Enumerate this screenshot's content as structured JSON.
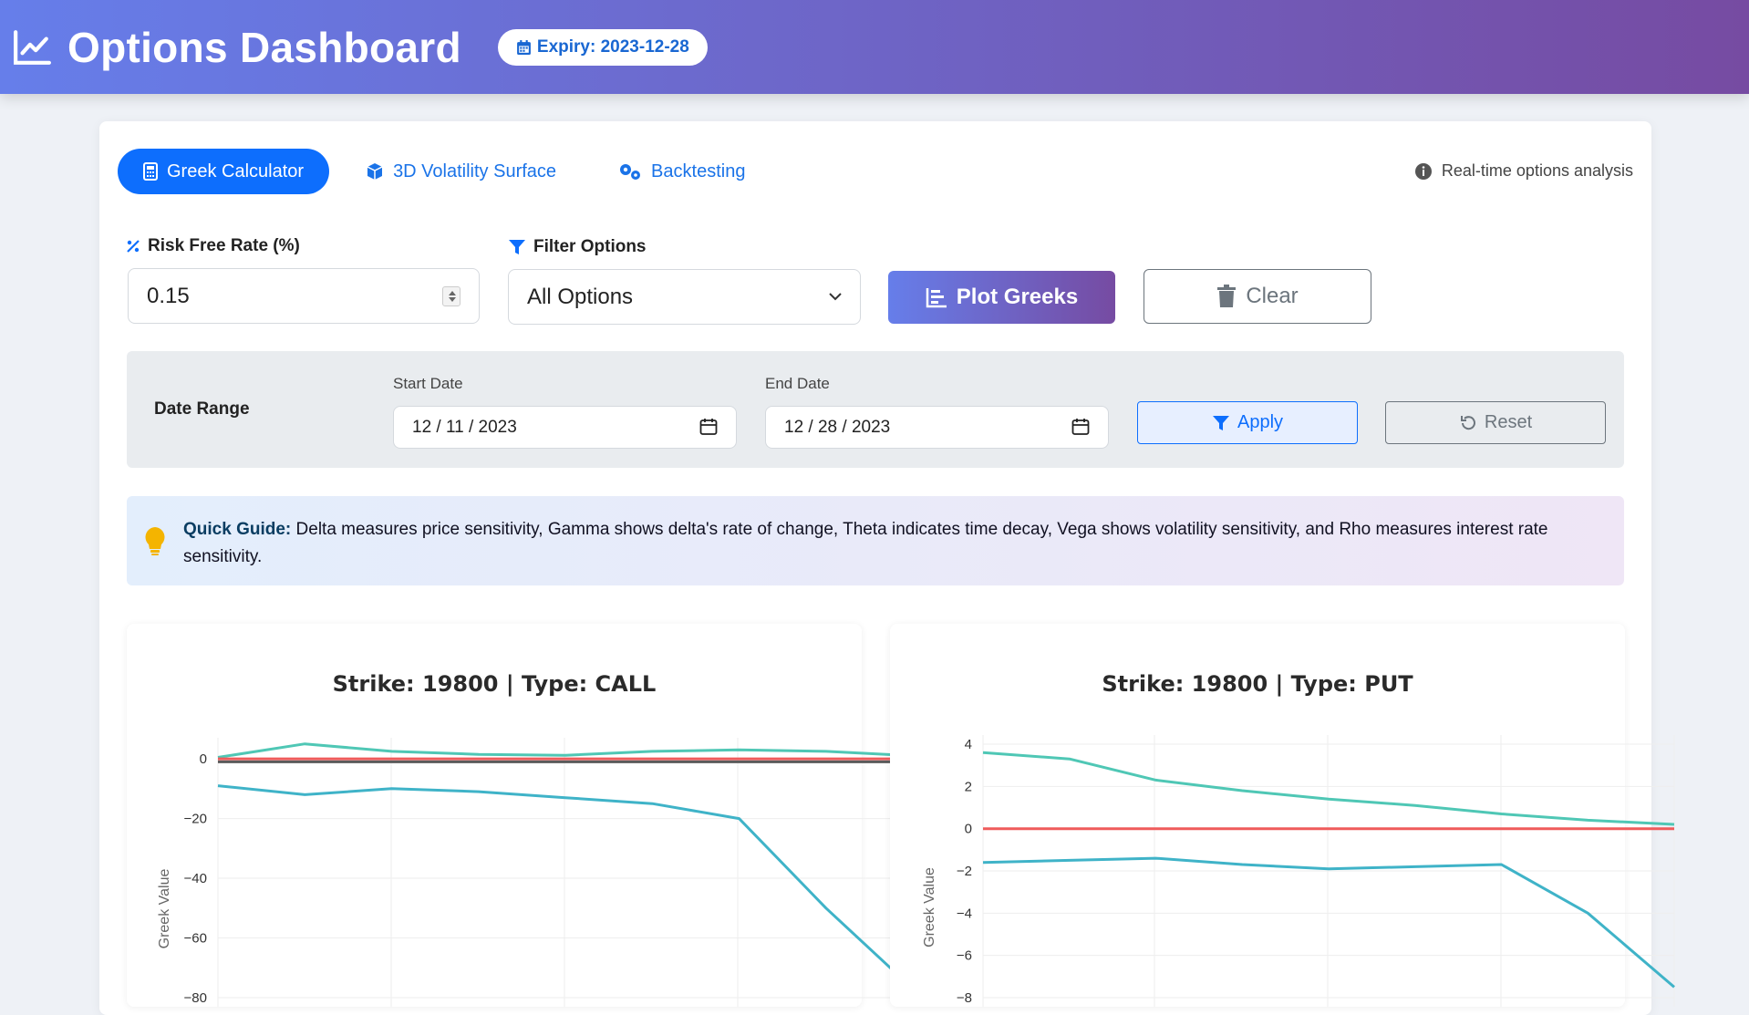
{
  "header": {
    "title": "Options Dashboard",
    "expiry_label": "Expiry: 2023-12-28"
  },
  "tabs": [
    {
      "label": "Greek Calculator",
      "icon": "calculator-icon",
      "active": true
    },
    {
      "label": "3D Volatility Surface",
      "icon": "cube-icon",
      "active": false
    },
    {
      "label": "Backtesting",
      "icon": "gears-icon",
      "active": false
    }
  ],
  "info_note": "Real-time options analysis",
  "controls": {
    "risk_free_label": "Risk Free Rate (%)",
    "risk_free_value": "0.15",
    "filter_label": "Filter Options",
    "filter_value": "All Options",
    "plot_button": "Plot Greeks",
    "clear_button": "Clear"
  },
  "date_range": {
    "label": "Date Range",
    "start_label": "Start Date",
    "start_value": "12 / 11 / 2023",
    "end_label": "End Date",
    "end_value": "12 / 28 / 2023",
    "apply_button": "Apply",
    "reset_button": "Reset"
  },
  "guide": {
    "heading": "Quick Guide:",
    "text": "Delta measures price sensitivity, Gamma shows delta's rate of change, Theta indicates time decay, Vega shows volatility sensitivity, and Rho measures interest rate sensitivity."
  },
  "colors": {
    "accent": "#0d6efd",
    "gradient_start": "#667eea",
    "gradient_end": "#764ba2",
    "series_teal": "#4fc7b5",
    "series_blue": "#3fb3c8",
    "series_red": "#ef5b5b"
  },
  "chart_data": [
    {
      "type": "line",
      "title": "Strike: 19800 | Type: CALL",
      "ylabel": "Greek Value",
      "ylim": [
        -80,
        4
      ],
      "yticks": [
        0,
        -20,
        -40,
        -60,
        -80
      ],
      "series": [
        {
          "color": "#4fc7b5",
          "values": [
            0.5,
            5,
            2.5,
            1.5,
            1.2,
            2.5,
            3.0,
            2.5,
            1
          ]
        },
        {
          "color": "#ef5b5b",
          "values": [
            0,
            0,
            0,
            0,
            0,
            0,
            0,
            0,
            0
          ]
        },
        {
          "color": "#5a5a5a",
          "values": [
            -1,
            -1,
            -1,
            -1,
            -1,
            -1,
            -1,
            -1,
            -1
          ]
        },
        {
          "color": "#3fb3c8",
          "values": [
            -9,
            -12,
            -10,
            -11,
            -13,
            -15,
            -20,
            -50,
            -77
          ]
        }
      ]
    },
    {
      "type": "line",
      "title": "Strike: 19800 | Type: PUT",
      "ylabel": "Greek Value",
      "ylim": [
        -8,
        4
      ],
      "yticks": [
        4,
        2,
        0,
        -2,
        -4,
        -6,
        -8
      ],
      "series": [
        {
          "color": "#4fc7b5",
          "values": [
            3.6,
            3.3,
            2.3,
            1.8,
            1.4,
            1.1,
            0.7,
            0.4,
            0.2
          ]
        },
        {
          "color": "#ef5b5b",
          "values": [
            0,
            0,
            0,
            0,
            0,
            0,
            0,
            0,
            0
          ]
        },
        {
          "color": "#3fb3c8",
          "values": [
            -1.6,
            -1.5,
            -1.4,
            -1.7,
            -1.9,
            -1.8,
            -1.7,
            -4.0,
            -7.5
          ]
        }
      ]
    }
  ]
}
